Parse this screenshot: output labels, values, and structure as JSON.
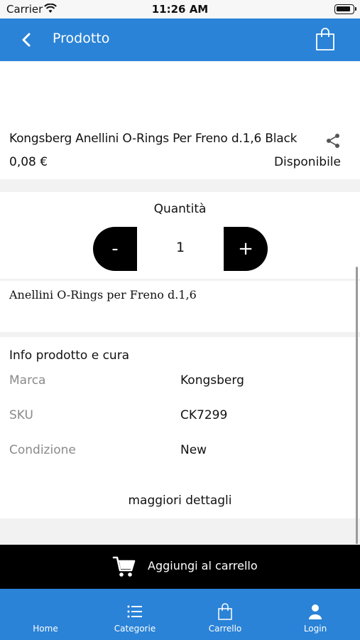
{
  "status_bar": {
    "carrier": "Carrier",
    "time": "11:26 AM"
  },
  "header": {
    "title": "Prodotto",
    "back_icon": "chevron-left-icon",
    "bag_icon": "shopping-bag-icon"
  },
  "product": {
    "name": "Kongsberg Anellini O-Rings Per Freno d.1,6 Black",
    "price": "0,08 €",
    "availability": "Disponibile",
    "share_icon": "share-icon"
  },
  "quantity": {
    "label": "Quantità",
    "minus": "-",
    "plus": "+",
    "value": "1"
  },
  "description": "Anellini O-Rings per Freno d.1,6",
  "info": {
    "title": "Info prodotto e cura",
    "rows": [
      {
        "label": "Marca",
        "value": "Kongsberg"
      },
      {
        "label": "SKU",
        "value": "CK7299"
      },
      {
        "label": "Condizione",
        "value": "New"
      }
    ],
    "more": "maggiori dettagli"
  },
  "add_to_cart": {
    "label": "Aggiungi al carrello",
    "icon": "cart-icon"
  },
  "tabbar": {
    "tabs": [
      {
        "label": "Home",
        "icon": "home-icon"
      },
      {
        "label": "Categorie",
        "icon": "list-icon"
      },
      {
        "label": "Carrello",
        "icon": "shopping-bag-icon"
      },
      {
        "label": "Login",
        "icon": "user-icon"
      }
    ]
  },
  "colors": {
    "primary": "#2a83d7",
    "button": "#000000",
    "muted_text": "#8a8a8a"
  }
}
